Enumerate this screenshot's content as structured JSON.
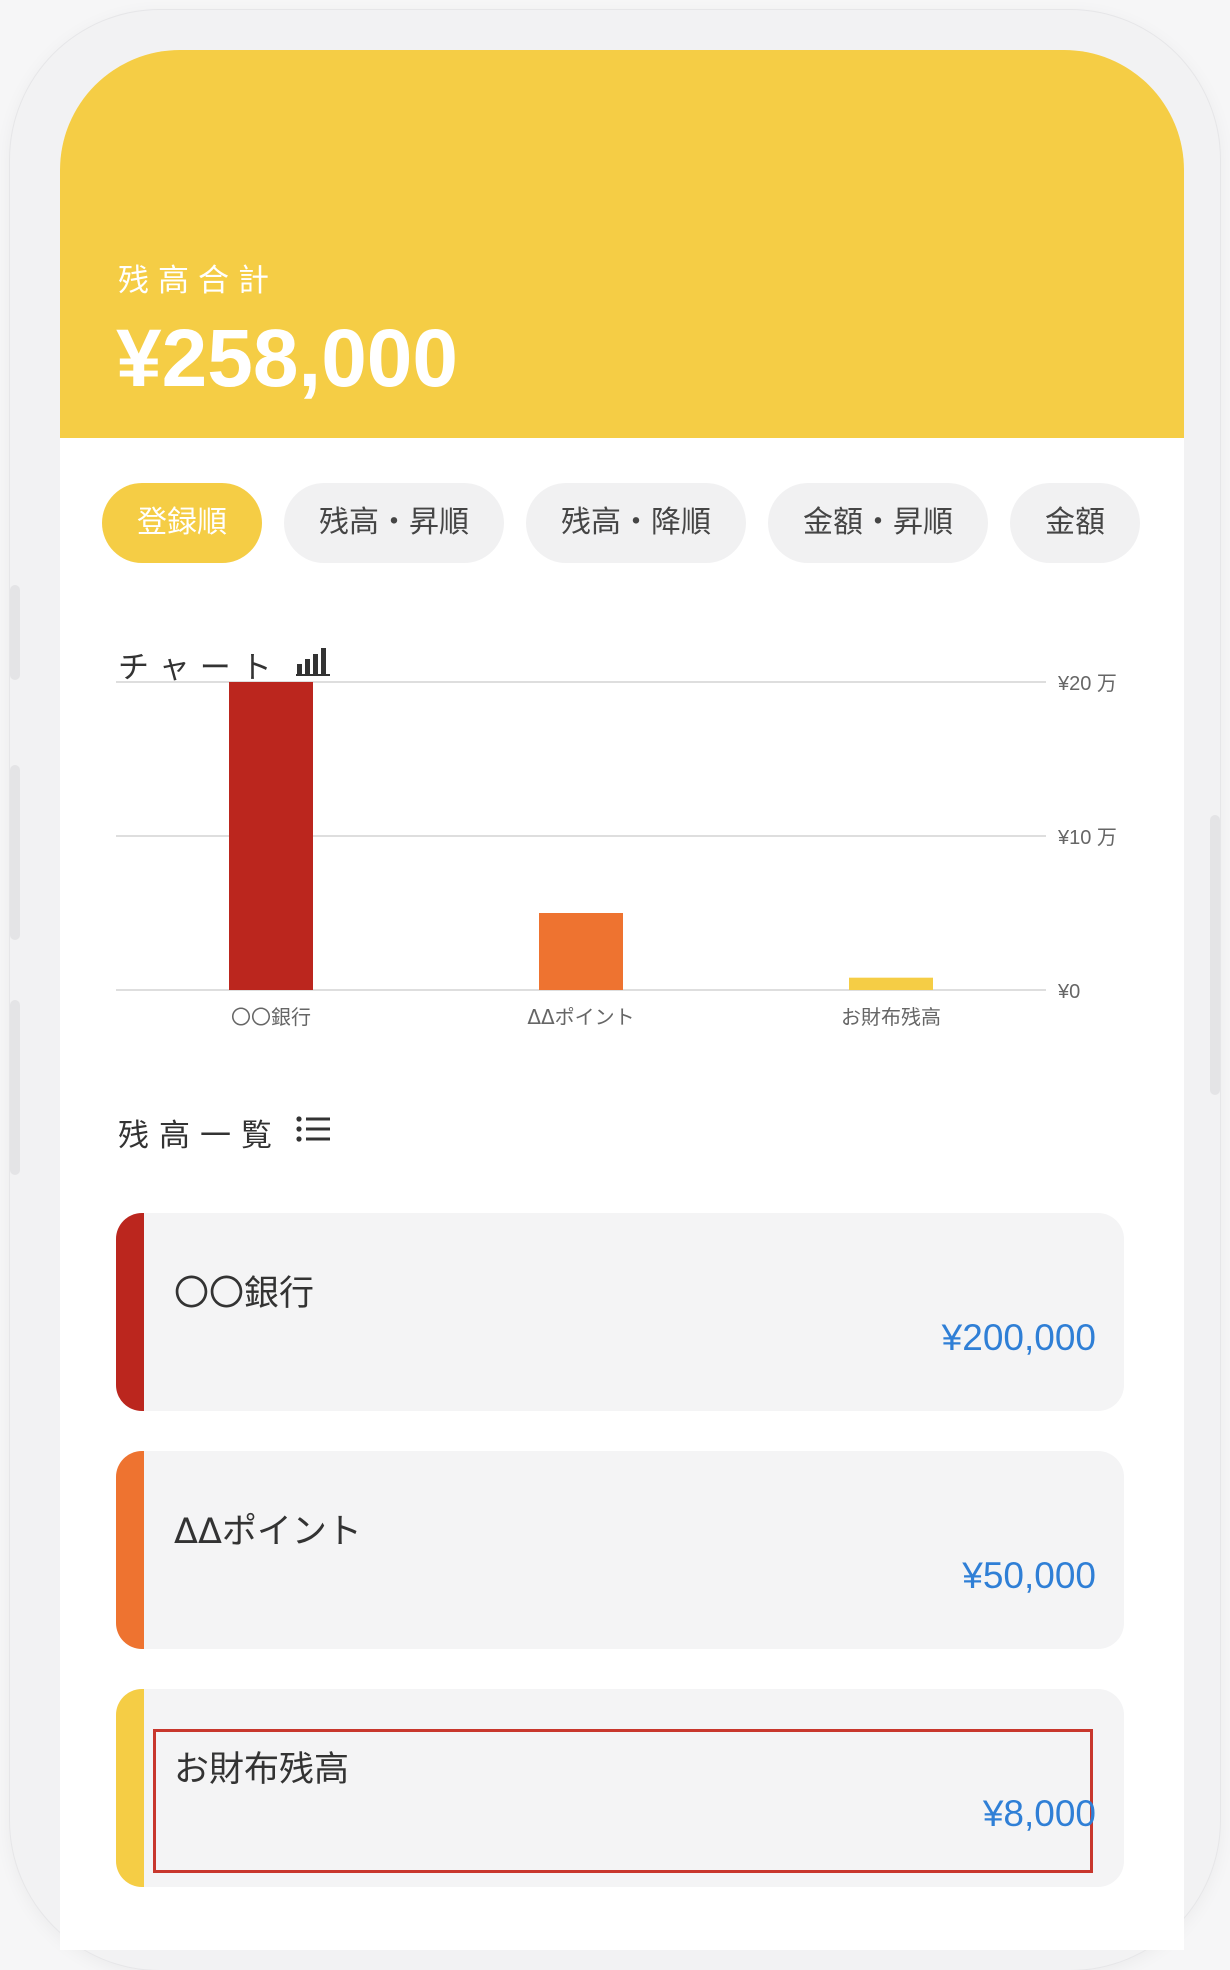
{
  "header": {
    "label": "残高合計",
    "total": "¥258,000"
  },
  "sort_tabs": [
    {
      "label": "登録順",
      "active": true
    },
    {
      "label": "残高・昇順",
      "active": false
    },
    {
      "label": "残高・降順",
      "active": false
    },
    {
      "label": "金額・昇順",
      "active": false
    },
    {
      "label": "金額",
      "active": false
    }
  ],
  "chart_section": {
    "title": "チャート",
    "icon": "bar-chart-icon"
  },
  "chart_data": {
    "type": "bar",
    "categories": [
      "〇〇銀行",
      "ΔΔポイント",
      "お財布残高"
    ],
    "values": [
      200000,
      50000,
      8000
    ],
    "colors": [
      "#bb261e",
      "#ee7330",
      "#f5cd45"
    ],
    "ylim": [
      0,
      200000
    ],
    "yticks": [
      {
        "value": 200000,
        "label": "¥20 万"
      },
      {
        "value": 100000,
        "label": "¥10 万"
      },
      {
        "value": 0,
        "label": "¥0"
      }
    ],
    "grid": true
  },
  "list_section": {
    "title": "残高一覧",
    "icon": "list-icon"
  },
  "balances": [
    {
      "name": "〇〇銀行",
      "amount": "¥200,000",
      "color": "#bb261e",
      "highlighted": false
    },
    {
      "name": "ΔΔポイント",
      "amount": "¥50,000",
      "color": "#ee7330",
      "highlighted": false
    },
    {
      "name": "お財布残高",
      "amount": "¥8,000",
      "color": "#f5cd45",
      "highlighted": true
    }
  ],
  "colors": {
    "accent": "#f5cd45",
    "amount_text": "#2f7fd6",
    "highlight_border": "#c8372d"
  }
}
